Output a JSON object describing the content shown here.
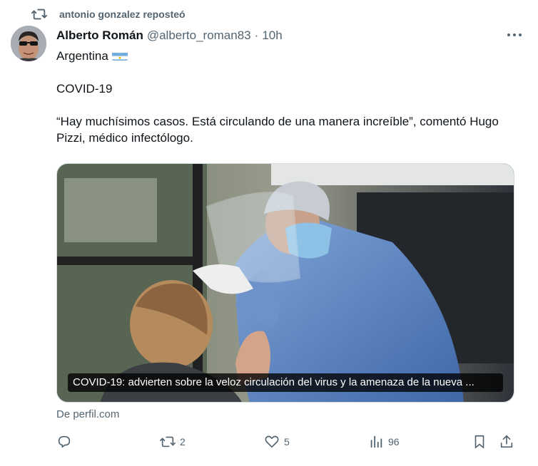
{
  "repost": {
    "icon": "repost-icon",
    "text": "antonio gonzalez reposteó"
  },
  "author": {
    "name": "Alberto Román",
    "handle": "@alberto_roman83",
    "separator": "·",
    "time": "10h"
  },
  "tweet": {
    "lines": [
      "Argentina",
      "COVID-19",
      "“Hay muchísimos casos. Está circulando de una manera increíble”, comentó Hugo Pizzi, médico infectólogo."
    ],
    "flag_icon": "argentina-flag-icon"
  },
  "media": {
    "caption": "COVID-19: advierten sobre la veloz circulación del virus y la amenaza de la nueva ...",
    "source": "De perfil.com"
  },
  "actions": {
    "reply": {
      "icon": "reply-icon",
      "count": ""
    },
    "repost": {
      "icon": "repost-icon",
      "count": "2"
    },
    "like": {
      "icon": "heart-icon",
      "count": "5"
    },
    "views": {
      "icon": "views-chart-icon",
      "count": "96"
    },
    "bookmark": {
      "icon": "bookmark-icon"
    },
    "share": {
      "icon": "share-icon"
    }
  },
  "colors": {
    "text_primary": "#0f1419",
    "text_secondary": "#536471",
    "border": "#cfd9de",
    "flag_blue": "#74acdf"
  }
}
